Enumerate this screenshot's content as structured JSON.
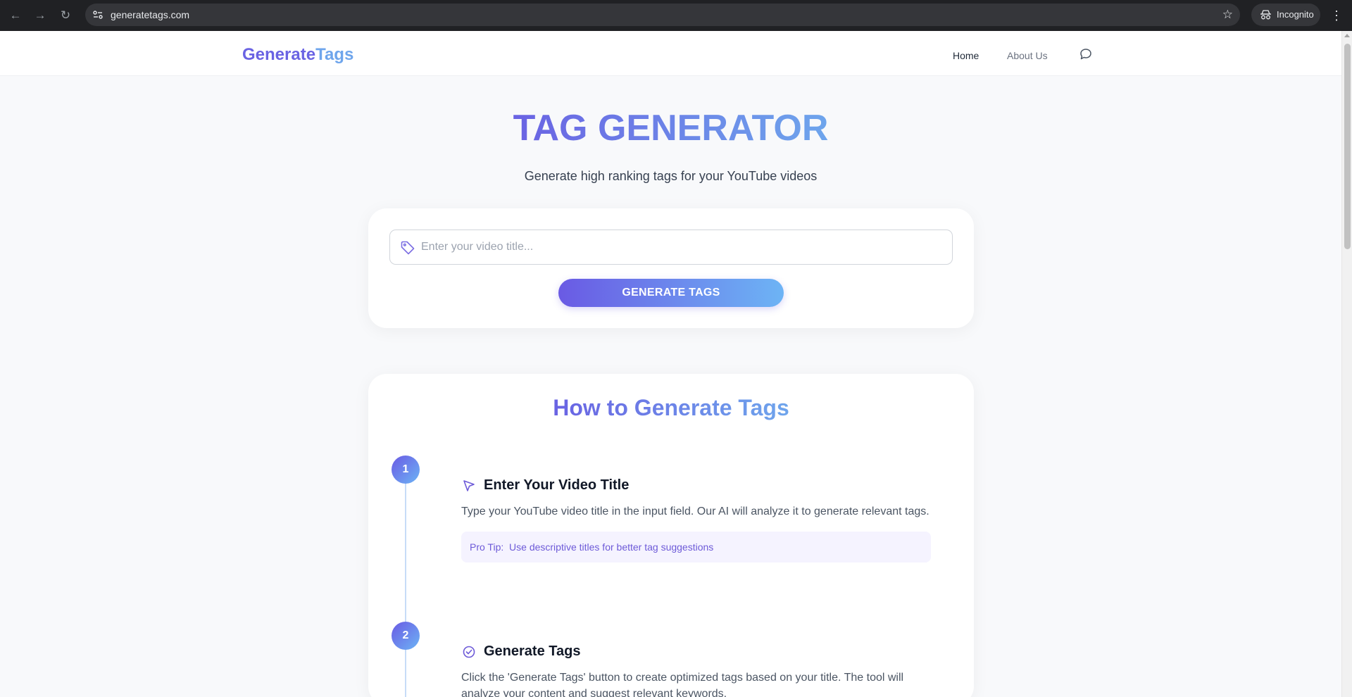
{
  "browser": {
    "url": "generatetags.com",
    "incognito_label": "Incognito"
  },
  "header": {
    "logo_part1": "Generate",
    "logo_part2": "Tags",
    "nav": {
      "home": "Home",
      "about": "About Us"
    }
  },
  "hero": {
    "title": "TAG GENERATOR",
    "subtitle": "Generate high ranking tags for your YouTube videos"
  },
  "form": {
    "placeholder": "Enter your video title...",
    "value": "",
    "button_label": "GENERATE TAGS"
  },
  "how_to": {
    "title": "How to Generate Tags",
    "steps": [
      {
        "number": "1",
        "icon": "cursor-arrow-icon",
        "title": "Enter Your Video Title",
        "description": "Type your YouTube video title in the input field. Our AI will analyze it to generate relevant tags.",
        "tip_label": "Pro Tip:",
        "tip_text": "Use descriptive titles for better tag suggestions"
      },
      {
        "number": "2",
        "icon": "check-circle-icon",
        "title": "Generate Tags",
        "description": "Click the 'Generate Tags' button to create optimized tags based on your title. The tool will analyze your content and suggest relevant keywords."
      }
    ]
  },
  "colors": {
    "accent_start": "#6a5ae4",
    "accent_end": "#6db4f5",
    "page_bg": "#f8f9fb"
  }
}
